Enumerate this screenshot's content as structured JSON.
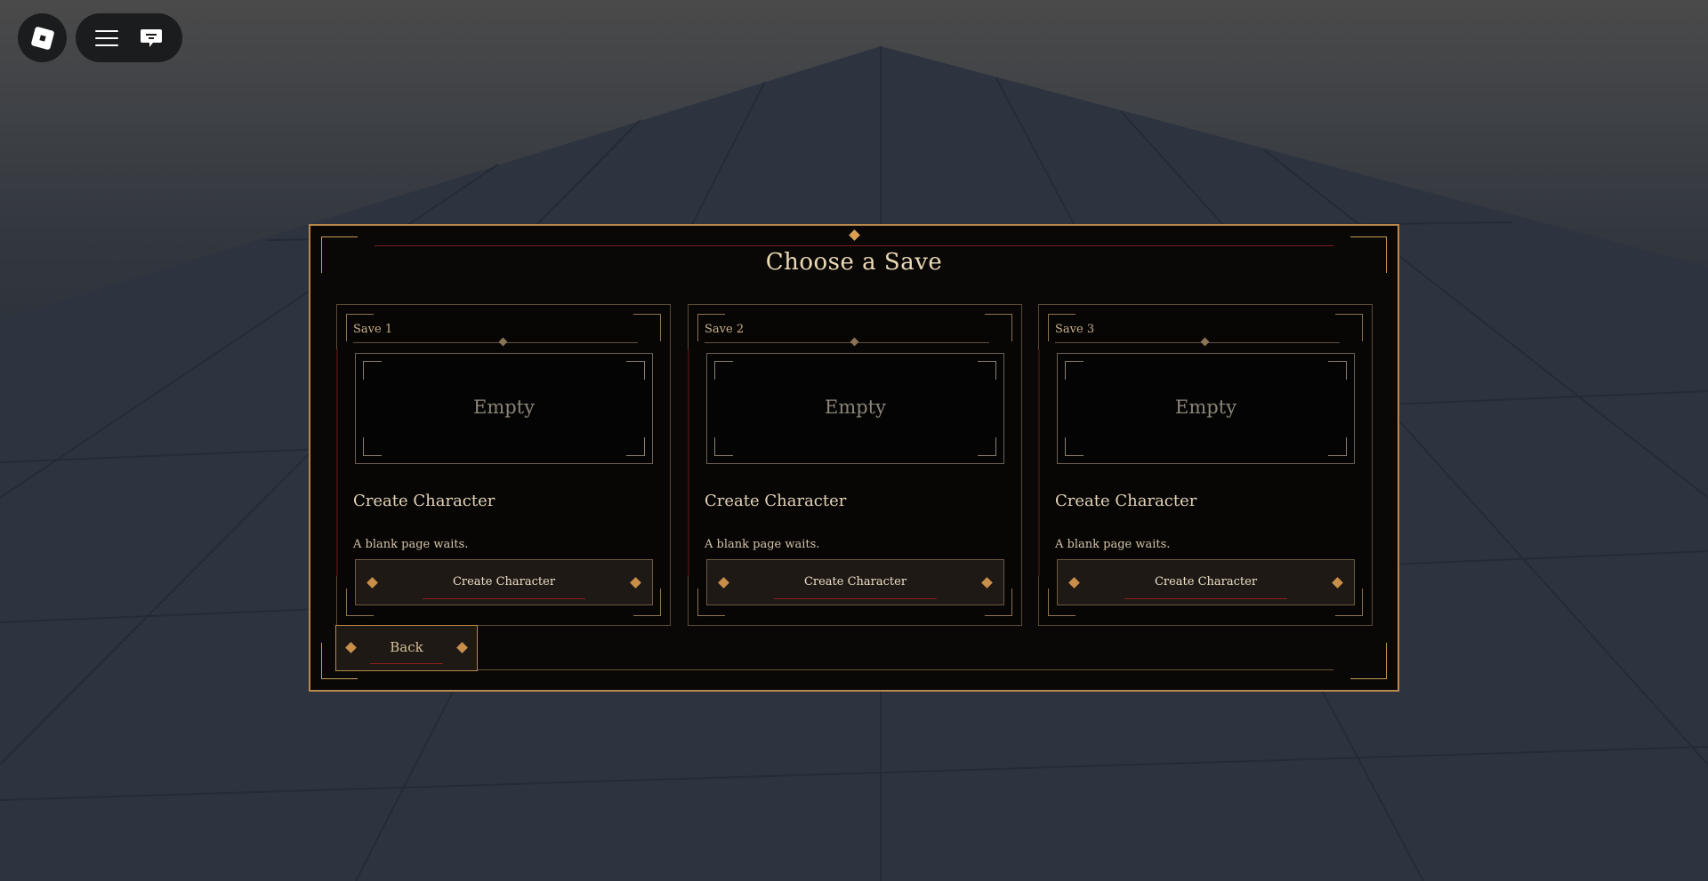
{
  "colors": {
    "panel_bg": "#090807",
    "gold_accent": "#b8894a",
    "diamond": "#c98f4a",
    "underline_red": "#8b2020",
    "title_text": "#ecd9b5"
  },
  "topbar": {
    "roblox_icon": "roblox-logo-icon",
    "menu_icon": "hamburger-menu-icon",
    "chat_icon": "chat-bubble-icon"
  },
  "dialog": {
    "title": "Choose a Save",
    "saves": [
      {
        "label": "Save 1",
        "preview_text": "Empty",
        "name": "Create Character",
        "description": "A blank page waits.",
        "button_label": "Create Character"
      },
      {
        "label": "Save 2",
        "preview_text": "Empty",
        "name": "Create Character",
        "description": "A blank page waits.",
        "button_label": "Create Character"
      },
      {
        "label": "Save 3",
        "preview_text": "Empty",
        "name": "Create Character",
        "description": "A blank page waits.",
        "button_label": "Create Character"
      }
    ],
    "back_label": "Back"
  }
}
